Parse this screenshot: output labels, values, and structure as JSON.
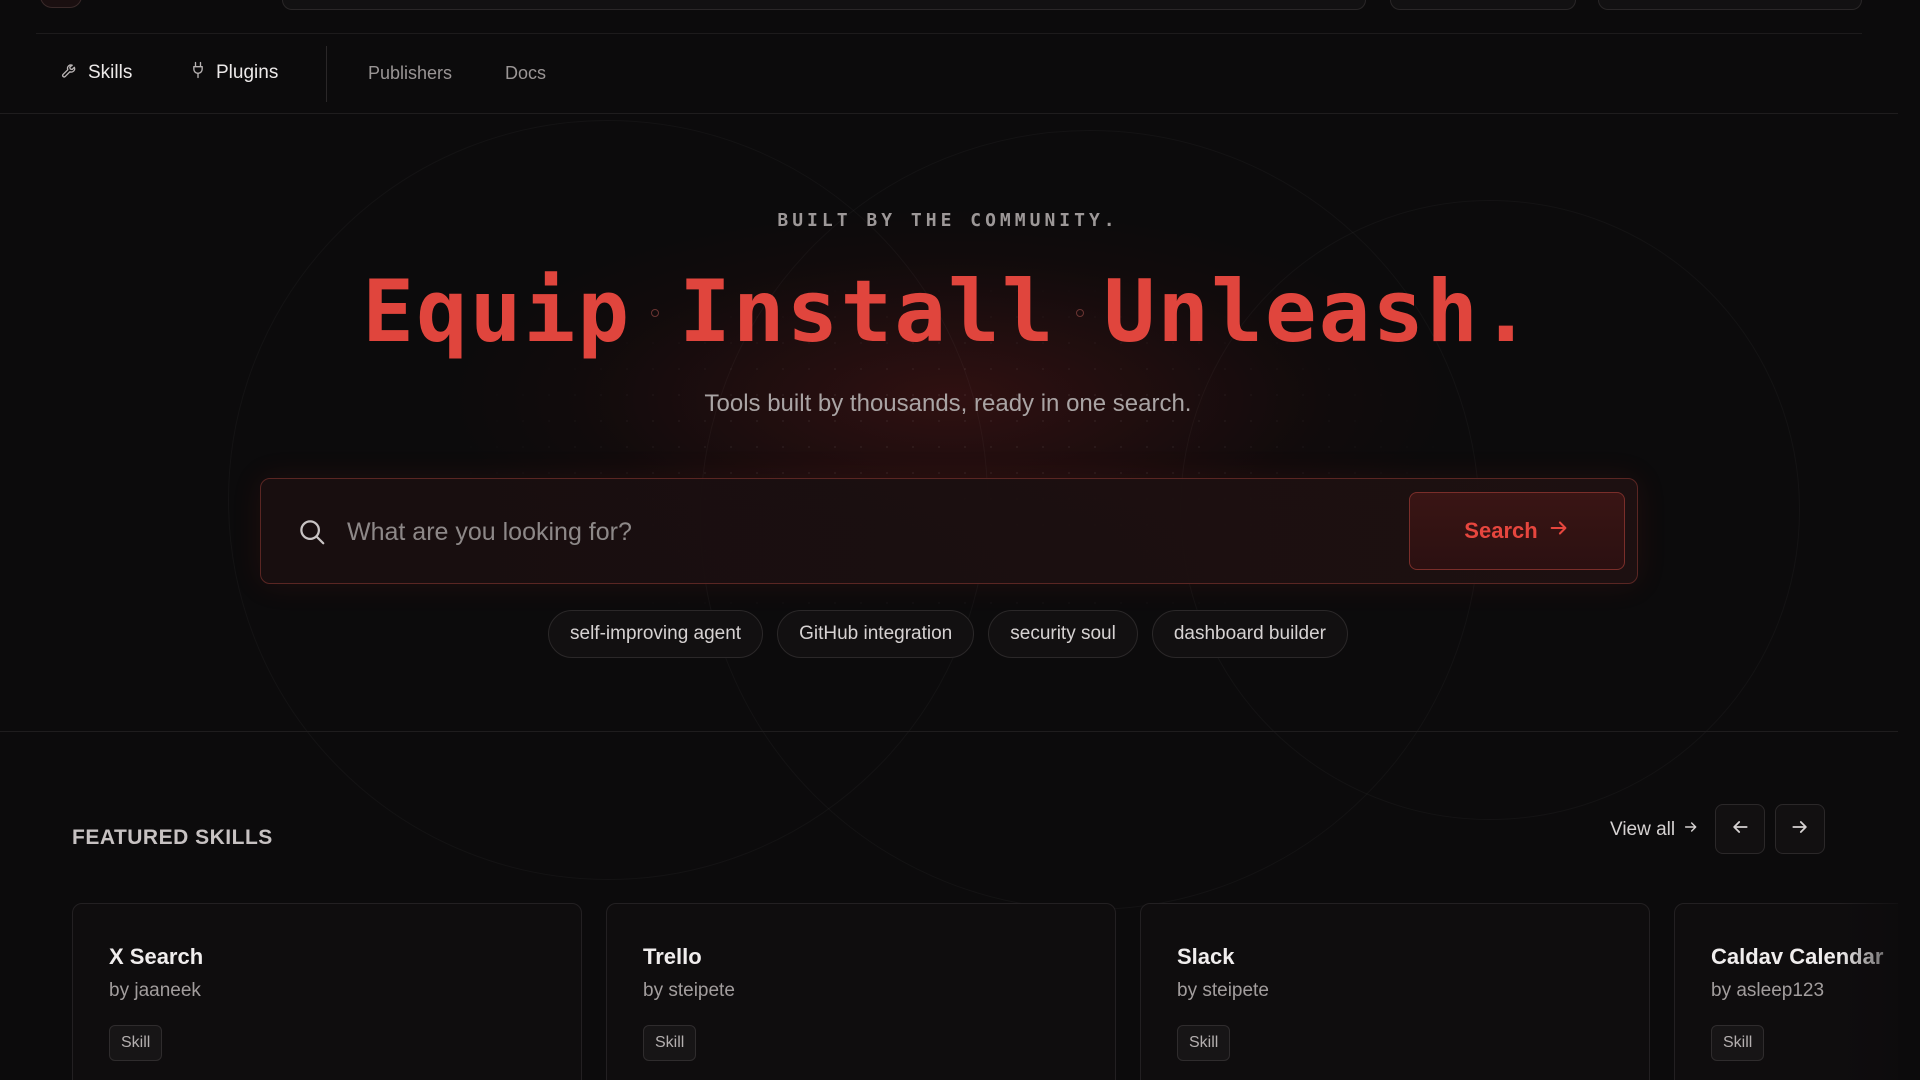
{
  "colors": {
    "accent": "#e0453d",
    "background": "#0c0b0c",
    "card": "#0f0d0e",
    "border": "#2b2829"
  },
  "nav": {
    "items": [
      {
        "label": "Skills",
        "icon": "wrench-icon"
      },
      {
        "label": "Plugins",
        "icon": "plug-icon"
      },
      {
        "label": "Publishers"
      },
      {
        "label": "Docs"
      }
    ]
  },
  "hero": {
    "eyebrow": "BUILT BY THE COMMUNITY.",
    "headline_words": [
      "Equip",
      "Install",
      "Unleash."
    ],
    "subtitle": "Tools built by thousands, ready in one search.",
    "search": {
      "placeholder": "What are you looking for?",
      "value": "",
      "button_label": "Search",
      "icon": "search-icon",
      "button_icon": "arrow-right-icon"
    },
    "suggestions": [
      "self-improving agent",
      "GitHub integration",
      "security soul",
      "dashboard builder"
    ]
  },
  "featured": {
    "title": "FEATURED SKILLS",
    "view_all_label": "View all",
    "prev_icon": "arrow-left-icon",
    "next_icon": "arrow-right-icon",
    "cards": [
      {
        "title": "X Search",
        "author": "by jaaneek",
        "badge": "Skill"
      },
      {
        "title": "Trello",
        "author": "by steipete",
        "badge": "Skill"
      },
      {
        "title": "Slack",
        "author": "by steipete",
        "badge": "Skill"
      },
      {
        "title": "Caldav Calendar",
        "author": "by asleep123",
        "badge": "Skill"
      }
    ]
  }
}
